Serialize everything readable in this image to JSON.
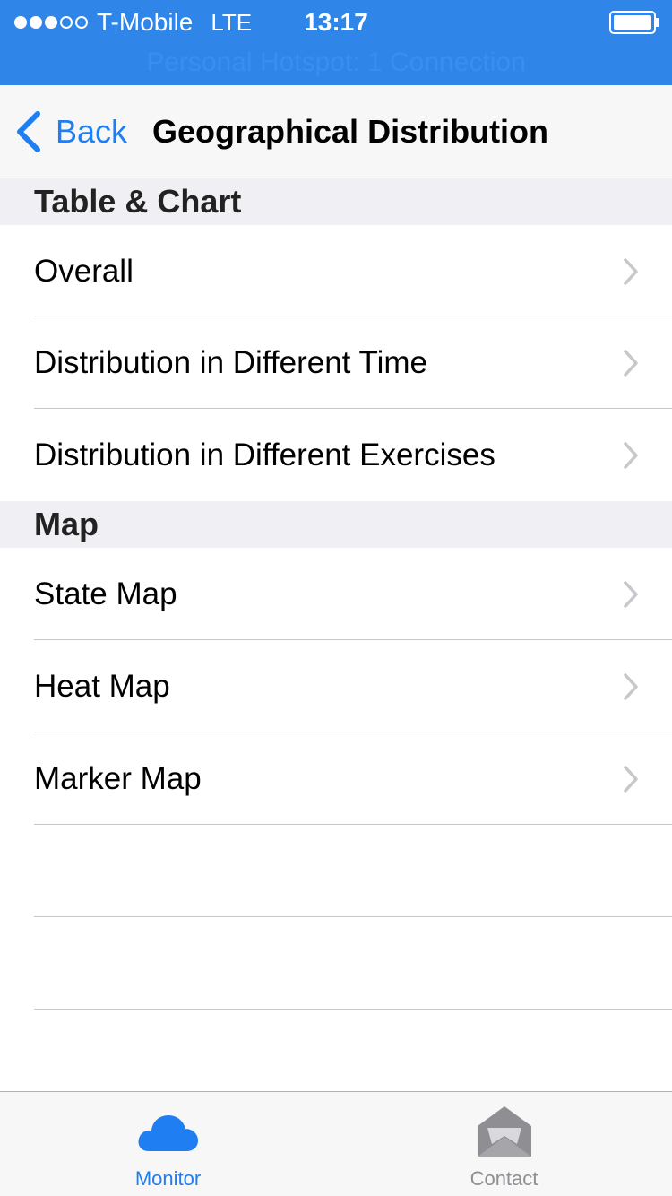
{
  "status_bar": {
    "carrier": "T-Mobile",
    "network": "LTE",
    "time": "13:17",
    "hotspot_text": "Personal Hotspot: 1 Connection",
    "signal_bars_filled": 3,
    "signal_bars_total": 5,
    "battery_level": 1.0
  },
  "nav": {
    "back_label": "Back",
    "title": "Geographical Distribution"
  },
  "sections": [
    {
      "header": "Table & Chart",
      "items": [
        {
          "label": "Overall"
        },
        {
          "label": "Distribution in Different Time"
        },
        {
          "label": "Distribution in Different Exercises"
        }
      ]
    },
    {
      "header": "Map",
      "items": [
        {
          "label": "State Map"
        },
        {
          "label": "Heat Map"
        },
        {
          "label": "Marker Map"
        }
      ]
    }
  ],
  "tab_bar": {
    "tabs": [
      {
        "label": "Monitor",
        "icon": "cloud-icon",
        "active": true
      },
      {
        "label": "Contact",
        "icon": "envelope-icon",
        "active": false
      }
    ]
  },
  "colors": {
    "status_bar_bg": "#2f86e8",
    "accent": "#1f7ef2",
    "inactive_tab": "#8e8e93",
    "section_header_bg": "#efeff4"
  }
}
